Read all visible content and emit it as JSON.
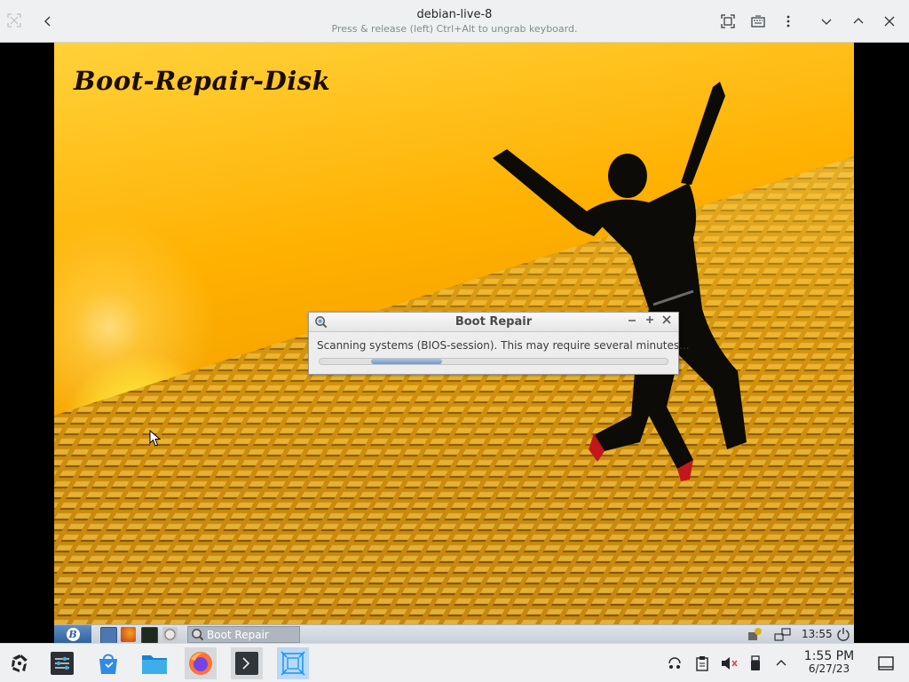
{
  "host_window": {
    "title": "debian-live-8",
    "subtitle": "Press & release (left) Ctrl+Alt to ungrab keyboard.",
    "icons": [
      "fullscreen-icon",
      "back-icon",
      "screen-fit-icon",
      "keyboard-icon",
      "menu-dots-icon",
      "minimize-icon",
      "maximize-icon",
      "close-icon"
    ]
  },
  "guest": {
    "wallpaper_logo": "Boot-Repair-Disk",
    "dialog": {
      "title": "Boot Repair",
      "message": "Scanning systems (BIOS-session). This may require several minutes...",
      "buttons": [
        "minimize",
        "maximize",
        "close"
      ],
      "progress_mode": "indeterminate"
    },
    "taskbar": {
      "start_letter": "B",
      "task_label": "Boot Repair",
      "clock": "13:55"
    }
  },
  "host_panel": {
    "launchers": [
      "application-launcher",
      "system-settings",
      "discover",
      "dolphin",
      "firefox",
      "konsole",
      "virt-manager"
    ],
    "clock_time": "1:55 PM",
    "clock_date": "6/27/23"
  },
  "colors": {
    "accent": "#3daee9",
    "panel_bg": "#eff0f1",
    "dialog_bg": "#ededed",
    "progress": "#6f98c8"
  }
}
